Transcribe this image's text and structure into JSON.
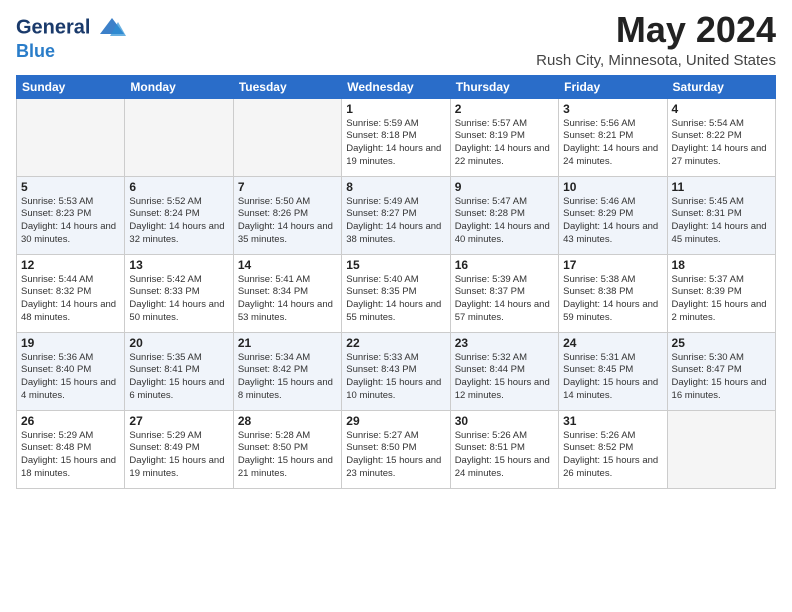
{
  "header": {
    "logo_line1": "General",
    "logo_line2": "Blue",
    "month_year": "May 2024",
    "location": "Rush City, Minnesota, United States"
  },
  "days_of_week": [
    "Sunday",
    "Monday",
    "Tuesday",
    "Wednesday",
    "Thursday",
    "Friday",
    "Saturday"
  ],
  "weeks": [
    [
      {
        "day": "",
        "empty": true
      },
      {
        "day": "",
        "empty": true
      },
      {
        "day": "",
        "empty": true
      },
      {
        "day": "1",
        "sunrise": "5:59 AM",
        "sunset": "8:18 PM",
        "daylight": "14 hours and 19 minutes."
      },
      {
        "day": "2",
        "sunrise": "5:57 AM",
        "sunset": "8:19 PM",
        "daylight": "14 hours and 22 minutes."
      },
      {
        "day": "3",
        "sunrise": "5:56 AM",
        "sunset": "8:21 PM",
        "daylight": "14 hours and 24 minutes."
      },
      {
        "day": "4",
        "sunrise": "5:54 AM",
        "sunset": "8:22 PM",
        "daylight": "14 hours and 27 minutes."
      }
    ],
    [
      {
        "day": "5",
        "sunrise": "5:53 AM",
        "sunset": "8:23 PM",
        "daylight": "14 hours and 30 minutes."
      },
      {
        "day": "6",
        "sunrise": "5:52 AM",
        "sunset": "8:24 PM",
        "daylight": "14 hours and 32 minutes."
      },
      {
        "day": "7",
        "sunrise": "5:50 AM",
        "sunset": "8:26 PM",
        "daylight": "14 hours and 35 minutes."
      },
      {
        "day": "8",
        "sunrise": "5:49 AM",
        "sunset": "8:27 PM",
        "daylight": "14 hours and 38 minutes."
      },
      {
        "day": "9",
        "sunrise": "5:47 AM",
        "sunset": "8:28 PM",
        "daylight": "14 hours and 40 minutes."
      },
      {
        "day": "10",
        "sunrise": "5:46 AM",
        "sunset": "8:29 PM",
        "daylight": "14 hours and 43 minutes."
      },
      {
        "day": "11",
        "sunrise": "5:45 AM",
        "sunset": "8:31 PM",
        "daylight": "14 hours and 45 minutes."
      }
    ],
    [
      {
        "day": "12",
        "sunrise": "5:44 AM",
        "sunset": "8:32 PM",
        "daylight": "14 hours and 48 minutes."
      },
      {
        "day": "13",
        "sunrise": "5:42 AM",
        "sunset": "8:33 PM",
        "daylight": "14 hours and 50 minutes."
      },
      {
        "day": "14",
        "sunrise": "5:41 AM",
        "sunset": "8:34 PM",
        "daylight": "14 hours and 53 minutes."
      },
      {
        "day": "15",
        "sunrise": "5:40 AM",
        "sunset": "8:35 PM",
        "daylight": "14 hours and 55 minutes."
      },
      {
        "day": "16",
        "sunrise": "5:39 AM",
        "sunset": "8:37 PM",
        "daylight": "14 hours and 57 minutes."
      },
      {
        "day": "17",
        "sunrise": "5:38 AM",
        "sunset": "8:38 PM",
        "daylight": "14 hours and 59 minutes."
      },
      {
        "day": "18",
        "sunrise": "5:37 AM",
        "sunset": "8:39 PM",
        "daylight": "15 hours and 2 minutes."
      }
    ],
    [
      {
        "day": "19",
        "sunrise": "5:36 AM",
        "sunset": "8:40 PM",
        "daylight": "15 hours and 4 minutes."
      },
      {
        "day": "20",
        "sunrise": "5:35 AM",
        "sunset": "8:41 PM",
        "daylight": "15 hours and 6 minutes."
      },
      {
        "day": "21",
        "sunrise": "5:34 AM",
        "sunset": "8:42 PM",
        "daylight": "15 hours and 8 minutes."
      },
      {
        "day": "22",
        "sunrise": "5:33 AM",
        "sunset": "8:43 PM",
        "daylight": "15 hours and 10 minutes."
      },
      {
        "day": "23",
        "sunrise": "5:32 AM",
        "sunset": "8:44 PM",
        "daylight": "15 hours and 12 minutes."
      },
      {
        "day": "24",
        "sunrise": "5:31 AM",
        "sunset": "8:45 PM",
        "daylight": "15 hours and 14 minutes."
      },
      {
        "day": "25",
        "sunrise": "5:30 AM",
        "sunset": "8:47 PM",
        "daylight": "15 hours and 16 minutes."
      }
    ],
    [
      {
        "day": "26",
        "sunrise": "5:29 AM",
        "sunset": "8:48 PM",
        "daylight": "15 hours and 18 minutes."
      },
      {
        "day": "27",
        "sunrise": "5:29 AM",
        "sunset": "8:49 PM",
        "daylight": "15 hours and 19 minutes."
      },
      {
        "day": "28",
        "sunrise": "5:28 AM",
        "sunset": "8:50 PM",
        "daylight": "15 hours and 21 minutes."
      },
      {
        "day": "29",
        "sunrise": "5:27 AM",
        "sunset": "8:50 PM",
        "daylight": "15 hours and 23 minutes."
      },
      {
        "day": "30",
        "sunrise": "5:26 AM",
        "sunset": "8:51 PM",
        "daylight": "15 hours and 24 minutes."
      },
      {
        "day": "31",
        "sunrise": "5:26 AM",
        "sunset": "8:52 PM",
        "daylight": "15 hours and 26 minutes."
      },
      {
        "day": "",
        "empty": true
      }
    ]
  ],
  "labels": {
    "sunrise": "Sunrise:",
    "sunset": "Sunset:",
    "daylight": "Daylight:"
  }
}
